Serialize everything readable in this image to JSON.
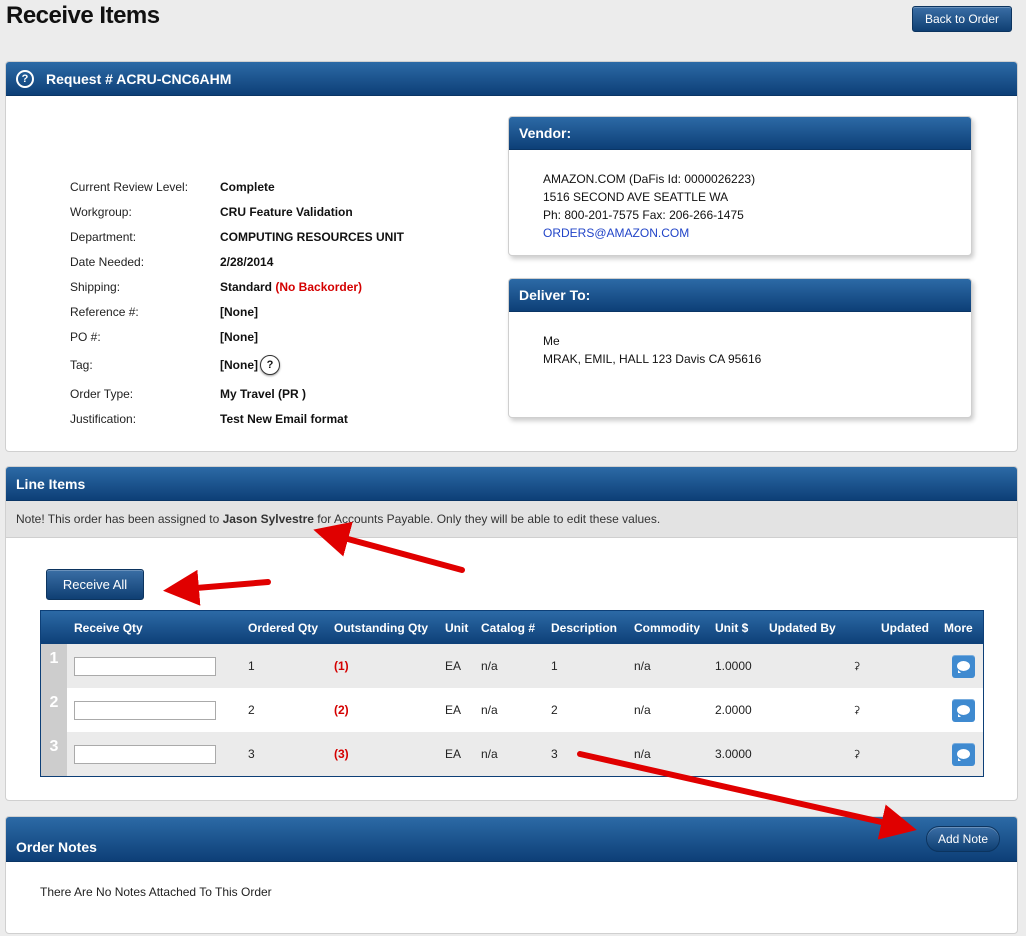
{
  "page": {
    "title": "Receive Items",
    "back_label": "Back to Order"
  },
  "request": {
    "heading": "Request # ACRU-CNC6AHM",
    "help_icon": "?",
    "fields": [
      {
        "label": "Current Review Level:",
        "value": "Complete"
      },
      {
        "label": "Workgroup:",
        "value": "CRU Feature Validation"
      },
      {
        "label": "Department:",
        "value": "COMPUTING RESOURCES UNIT"
      },
      {
        "label": "Date Needed:",
        "value": "2/28/2014"
      },
      {
        "label": "Shipping:",
        "value": "Standard",
        "extra": "(No Backorder)"
      },
      {
        "label": "Reference #:",
        "value": "[None]"
      },
      {
        "label": "PO #:",
        "value": "[None]"
      },
      {
        "label": "Tag:",
        "value": "[None]",
        "help": "?"
      },
      {
        "label": "Order Type:",
        "value": "My Travel (PR )"
      },
      {
        "label": "Justification:",
        "value": "Test New Email format"
      }
    ]
  },
  "vendor": {
    "heading": "Vendor:",
    "line1": "AMAZON.COM (DaFis Id: 0000026223)",
    "line2": "1516 SECOND AVE SEATTLE WA",
    "line3": "Ph: 800-201-7575 Fax: 206-266-1475",
    "email": "ORDERS@AMAZON.COM"
  },
  "deliver": {
    "heading": "Deliver To:",
    "line1": "Me",
    "line2": "MRAK, EMIL, HALL 123 Davis CA 95616"
  },
  "line_items": {
    "heading": "Line Items",
    "note_prefix": "Note! This order has been assigned to ",
    "note_name": "Jason Sylvestre",
    "note_suffix": " for Accounts Payable. Only they will be able to edit these values.",
    "receive_all_label": "Receive All",
    "columns": {
      "receive_qty": "Receive Qty",
      "ordered_qty": "Ordered Qty",
      "outstanding_qty": "Outstanding Qty",
      "unit": "Unit",
      "catalog": "Catalog #",
      "description": "Description",
      "commodity": "Commodity",
      "unit_price": "Unit $",
      "updated_by": "Updated By",
      "updated": "Updated",
      "more": "More"
    },
    "rows": [
      {
        "num": "1",
        "receive": "",
        "ordered": "1",
        "outstanding": "(1)",
        "unit": "EA",
        "catalog": "n/a",
        "description": "1",
        "commodity": "n/a",
        "unit_price": "1.0000"
      },
      {
        "num": "2",
        "receive": "",
        "ordered": "2",
        "outstanding": "(2)",
        "unit": "EA",
        "catalog": "n/a",
        "description": "2",
        "commodity": "n/a",
        "unit_price": "2.0000"
      },
      {
        "num": "3",
        "receive": "",
        "ordered": "3",
        "outstanding": "(3)",
        "unit": "EA",
        "catalog": "n/a",
        "description": "3",
        "commodity": "n/a",
        "unit_price": "3.0000"
      }
    ]
  },
  "order_notes": {
    "heading": "Order Notes",
    "add_note_label": "Add Note",
    "empty_text": "There Are No Notes Attached To This Order"
  },
  "icons": {
    "person": "user-icon",
    "note": "speech-bubble-icon",
    "help": "question-circle-icon"
  },
  "colors": {
    "header_blue": "#0d3f77",
    "accent_red": "#d40000",
    "link_blue": "#2144c8",
    "arrow_red": "#e00000"
  }
}
